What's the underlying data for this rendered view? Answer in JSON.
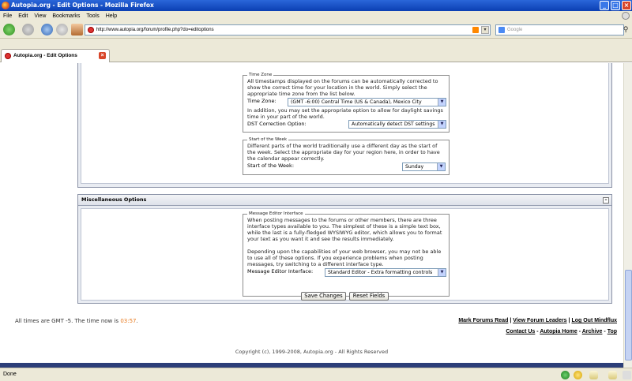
{
  "window": {
    "title": "Autopia.org - Edit Options - Mozilla Firefox"
  },
  "menu": [
    "File",
    "Edit",
    "View",
    "Bookmarks",
    "Tools",
    "Help"
  ],
  "navbar": {
    "url": "http://www.autopia.org/forum/profile.php?do=editoptions",
    "search_placeholder": "Google"
  },
  "tab": {
    "label": "Autopia.org - Edit Options"
  },
  "timezone": {
    "legend": "Time Zone",
    "description": "All timestamps displayed on the forums can be automatically corrected to show the correct time for your location in the world. Simply select the appropriate time zone from the list below.",
    "tz_label": "Time Zone:",
    "tz_value": "(GMT -6:00) Central Time (US & Canada), Mexico City",
    "dst_description": "In addition, you may set the appropriate option to allow for daylight savings time in your part of the world.",
    "dst_label": "DST Correction Option:",
    "dst_value": "Automatically detect DST settings"
  },
  "week": {
    "legend": "Start of the Week",
    "description": "Different parts of the world traditionally use a different day as the start of the week. Select the appropriate day for your region here, in order to have the calendar appear correctly.",
    "label": "Start of the Week:",
    "value": "Sunday"
  },
  "misc": {
    "title": "Miscellaneous Options",
    "legend": "Message Editor Interface",
    "description1": "When posting messages to the forums or other members, there are three interface types available to you. The simplest of these is a simple text box, while the last is a fully-fledged WYSIWYG editor, which allows you to format your text as you want it and see the results immediately.",
    "description2": "Depending upon the capabilities of your web browser, you may not be able to use all of these options. If you experience problems when posting messages, try switching to a different interface type.",
    "label": "Message Editor Interface:",
    "value": "Standard Editor - Extra formatting controls"
  },
  "buttons": {
    "save": "Save Changes",
    "reset": "Reset Fields"
  },
  "footer": {
    "times_prefix": "All times are GMT -5. The time now is",
    "time_now": "03:57",
    "times_suffix": ".",
    "link_mark_read": "Mark Forums Read",
    "link_leaders": "View Forum Leaders",
    "link_logout": "Log Out Mindflux",
    "link_contact": "Contact Us",
    "link_home": "Autopia Home",
    "link_archive": "Archive",
    "link_top": "Top",
    "sep": "|",
    "sep2": "-",
    "copyright": "Copyright (c), 1999-2008, Autopia.org - All Rights Reserved"
  },
  "status": {
    "text": "Done"
  },
  "colors": {
    "time_highlight": "#e87a1e",
    "titlebar": "#0b3fb3"
  }
}
